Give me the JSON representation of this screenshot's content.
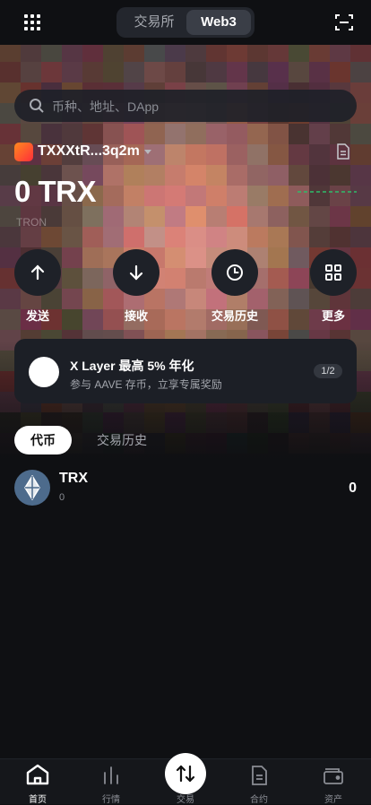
{
  "header": {
    "tabs": [
      {
        "label": "交易所",
        "active": false
      },
      {
        "label": "Web3",
        "active": true
      }
    ]
  },
  "search": {
    "placeholder": "币种、地址、DApp"
  },
  "account": {
    "name": "TXXXtR...3q2m"
  },
  "balance": {
    "amount": "0 TRX",
    "chain": "TRON"
  },
  "actions": [
    {
      "label": "发送",
      "icon": "arrow-up-icon"
    },
    {
      "label": "接收",
      "icon": "arrow-down-icon"
    },
    {
      "label": "交易历史",
      "icon": "clock-icon"
    },
    {
      "label": "更多",
      "icon": "grid-icon"
    }
  ],
  "banner": {
    "title": "X Layer 最高 5% 年化",
    "subtitle": "参与 AAVE 存币，立享专属奖励",
    "page": "1/2"
  },
  "asset_tabs": [
    {
      "label": "代币",
      "active": true
    },
    {
      "label": "交易历史",
      "active": false
    }
  ],
  "tokens": [
    {
      "symbol": "TRX",
      "amount": "0",
      "value": "0"
    }
  ],
  "tabbar": [
    {
      "label": "首页",
      "icon": "home-icon",
      "active": true
    },
    {
      "label": "行情",
      "icon": "market-chart-icon",
      "active": false
    },
    {
      "label": "交易",
      "icon": "swap-arrows-icon",
      "active": false
    },
    {
      "label": "合约",
      "icon": "document-icon",
      "active": false
    },
    {
      "label": "资产",
      "icon": "wallet-icon",
      "active": false
    }
  ],
  "colors": {
    "background": "#0f1013",
    "accent_positive": "#2ebd6b",
    "brand_gradient": [
      "#ff8a1f",
      "#ff2e3a"
    ]
  }
}
